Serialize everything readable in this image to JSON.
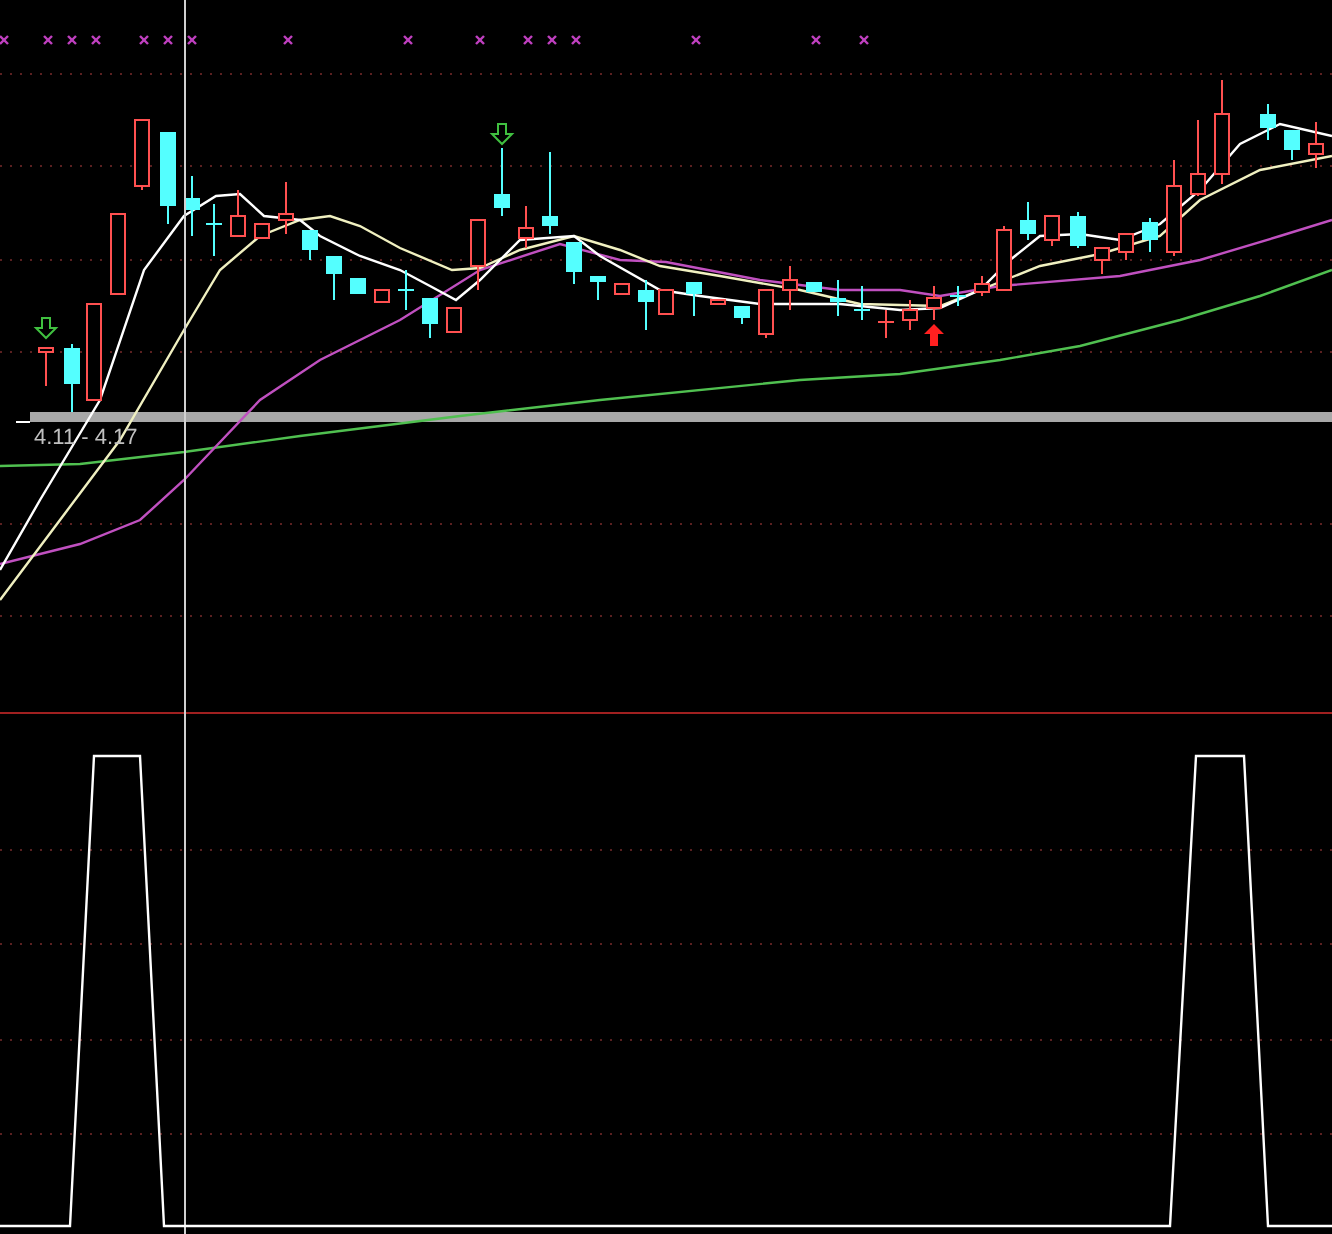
{
  "range_label": "4.11 - 4.17"
}
